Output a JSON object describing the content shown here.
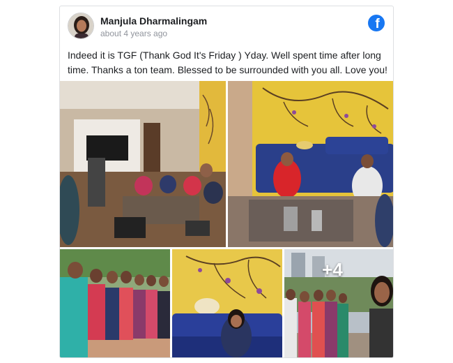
{
  "post": {
    "author_name": "Manjula Dharmalingam",
    "timestamp": "about 4 years ago",
    "text": "Indeed it is TGF (Thank God It's Friday ) Yday. Well spent time after long time. Thanks a ton team. Blessed to be surrounded with you all. Love you!",
    "platform_icon": "facebook-icon",
    "brand_color": "#1877f2"
  },
  "photos": {
    "count_visible": 5,
    "more_label": "+4"
  }
}
